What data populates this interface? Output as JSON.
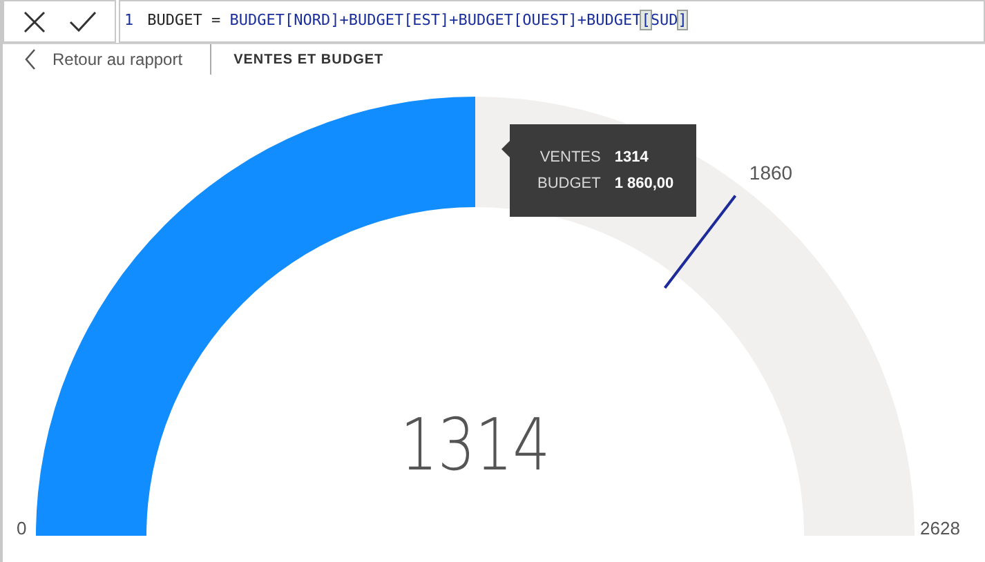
{
  "formula_bar": {
    "line_number": "1",
    "segments": [
      {
        "text": "BUDGET = ",
        "kind": "plain"
      },
      {
        "text": "BUDGET[NORD]+BUDGET[EST]+BUDGET[OUEST]+BUDGET",
        "kind": "ref"
      },
      {
        "text": "[",
        "kind": "match"
      },
      {
        "text": "SUD",
        "kind": "ref"
      },
      {
        "text": "]",
        "kind": "match"
      }
    ]
  },
  "nav": {
    "back_label": "Retour au rapport",
    "title": "VENTES ET BUDGET"
  },
  "gauge": {
    "level": 0.5,
    "value": "1314",
    "min": "0",
    "max": "2628",
    "target": "1860",
    "tooltip": [
      {
        "label": "VENTES",
        "value": "1314"
      },
      {
        "label": "BUDGET",
        "value": "1 860,00"
      }
    ]
  }
}
